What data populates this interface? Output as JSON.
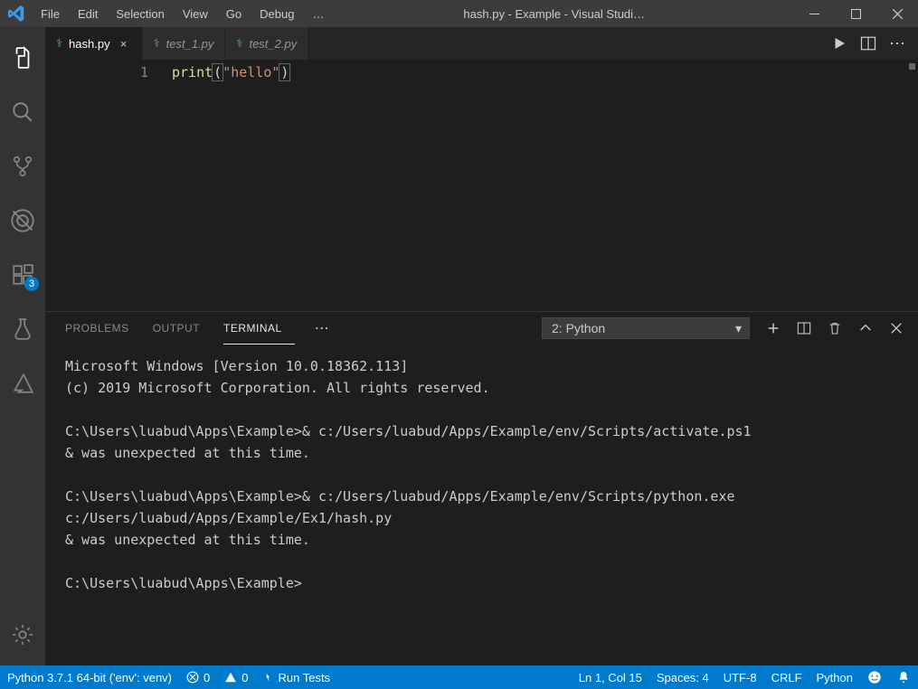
{
  "titlebar": {
    "menus": [
      "File",
      "Edit",
      "Selection",
      "View",
      "Go",
      "Debug",
      "…"
    ],
    "title": "hash.py - Example - Visual Studi…"
  },
  "activitybar": {
    "badge": "3"
  },
  "tabs": [
    {
      "label": "hash.py",
      "active": true,
      "close": "×"
    },
    {
      "label": "test_1.py",
      "active": false
    },
    {
      "label": "test_2.py",
      "active": false
    }
  ],
  "editor": {
    "lineno": "1",
    "fn": "print",
    "lp": "(",
    "str": "\"hello\"",
    "rp": ")"
  },
  "panel": {
    "tabs": [
      "PROBLEMS",
      "OUTPUT",
      "TERMINAL"
    ],
    "activeTab": "TERMINAL",
    "dots": "⋯",
    "terminalSelect": "2: Python",
    "content": "Microsoft Windows [Version 10.0.18362.113]\n(c) 2019 Microsoft Corporation. All rights reserved.\n\nC:\\Users\\luabud\\Apps\\Example>& c:/Users/luabud/Apps/Example/env/Scripts/activate.ps1\n& was unexpected at this time.\n\nC:\\Users\\luabud\\Apps\\Example>& c:/Users/luabud/Apps/Example/env/Scripts/python.exe c:/Users/luabud/Apps/Example/Ex1/hash.py\n& was unexpected at this time.\n\nC:\\Users\\luabud\\Apps\\Example>"
  },
  "statusbar": {
    "python": "Python 3.7.1 64-bit ('env': venv)",
    "errors": "0",
    "warnings": "0",
    "runTests": "Run Tests",
    "lncol": "Ln 1, Col 15",
    "spaces": "Spaces: 4",
    "enc": "UTF-8",
    "eol": "CRLF",
    "lang": "Python"
  }
}
